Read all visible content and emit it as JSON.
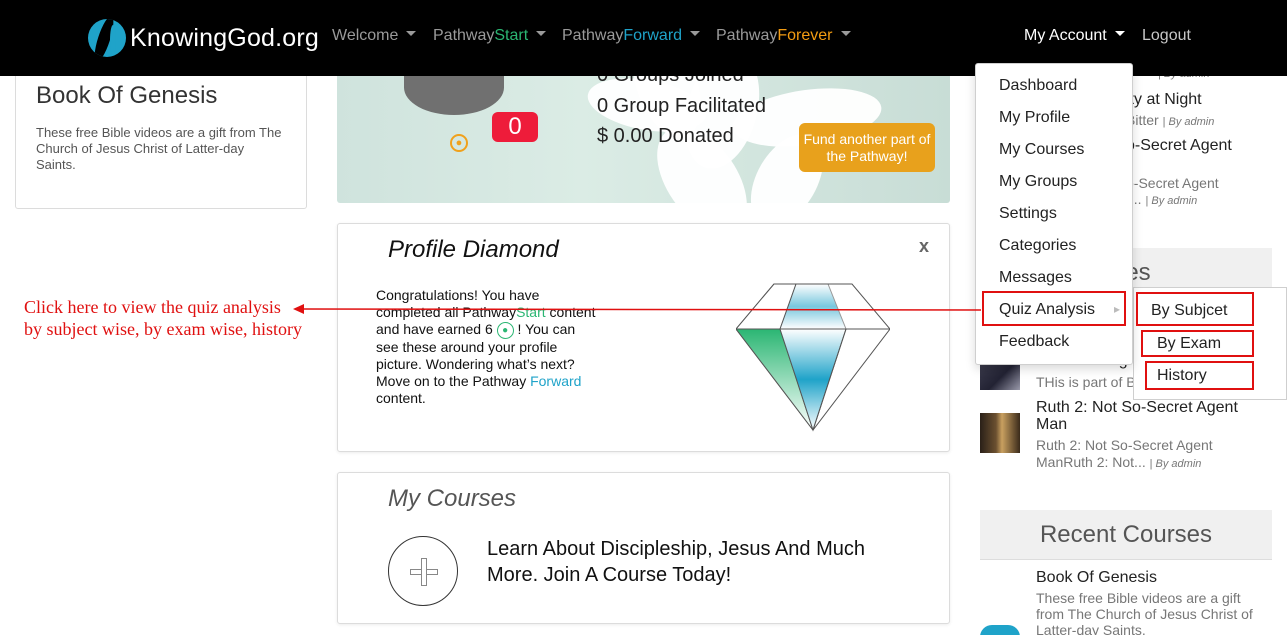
{
  "header": {
    "logo_text": "KnowingGod.org",
    "nav": [
      {
        "label": "Welcome"
      },
      {
        "label_pre": "Pathway",
        "label_post": "Start"
      },
      {
        "label_pre": "Pathway",
        "label_post": "Forward"
      },
      {
        "label_pre": "Pathway",
        "label_post": "Forever"
      }
    ],
    "account_label": "My Account",
    "logout_label": "Logout"
  },
  "left_card": {
    "title": "Book Of Genesis",
    "description": "These free Bible videos are a gift from The Church of Jesus Christ of Latter-day Saints."
  },
  "hero": {
    "badge_count": "0",
    "groups_joined": "0 Groups Joined",
    "groups_facilitated": "0 Group Facilitated",
    "donated": "$ 0.00 Donated",
    "fund_button": "Fund another part of the Pathway!"
  },
  "profile_diamond": {
    "title": "Profile Diamond",
    "close": "x",
    "text_1": "Congratulations! You have completed all Pathway",
    "text_start": "Start",
    "text_2": " content and have earned 6 ",
    "text_3": " ! You can see these around your profile picture. Wondering what’s next? Move on to the Pathway ",
    "text_forward": "Forward",
    "text_4": " content."
  },
  "my_courses": {
    "title": "My Courses",
    "cta": "Learn About Discipleship, Jesus And Much More. Join A Course Today!"
  },
  "right_column": {
    "partial_items": [
      {
        "title_tail": "ity at Night",
        "desc_tail": "Bitter",
        "by": "By admin"
      },
      {
        "title_tail": "o-Secret Agent",
        "desc_tail": "o-Secret Agent",
        "desc_tail2": "t...",
        "by": "By admin"
      }
    ],
    "top_by": "By admin",
    "section_tail": "les",
    "ruth_partial_title": "Ruth 3: Integ",
    "ruth_partial_desc": "THis is part of B",
    "ruth2": {
      "title": "Ruth 2: Not So-Secret Agent Man",
      "desc": "Ruth 2: Not So-Secret Agent ManRuth 2: Not...",
      "by": "By admin"
    },
    "recent_courses_heading": "Recent Courses",
    "recent_course": {
      "title": "Book Of Genesis",
      "desc": "These free Bible videos are a gift from The Church of Jesus Christ of Latter-day Saints."
    }
  },
  "account_menu": {
    "items": [
      "Dashboard",
      "My Profile",
      "My Courses",
      "My Groups",
      "Settings",
      "Categories",
      "Messages",
      "Quiz Analysis",
      "Feedback"
    ],
    "submenu": [
      "By Subjcet",
      "By Exam",
      "History"
    ]
  },
  "annotation": {
    "line1": "Click here to view the quiz analysis",
    "line2": "by subject wise, by exam wise, history"
  }
}
